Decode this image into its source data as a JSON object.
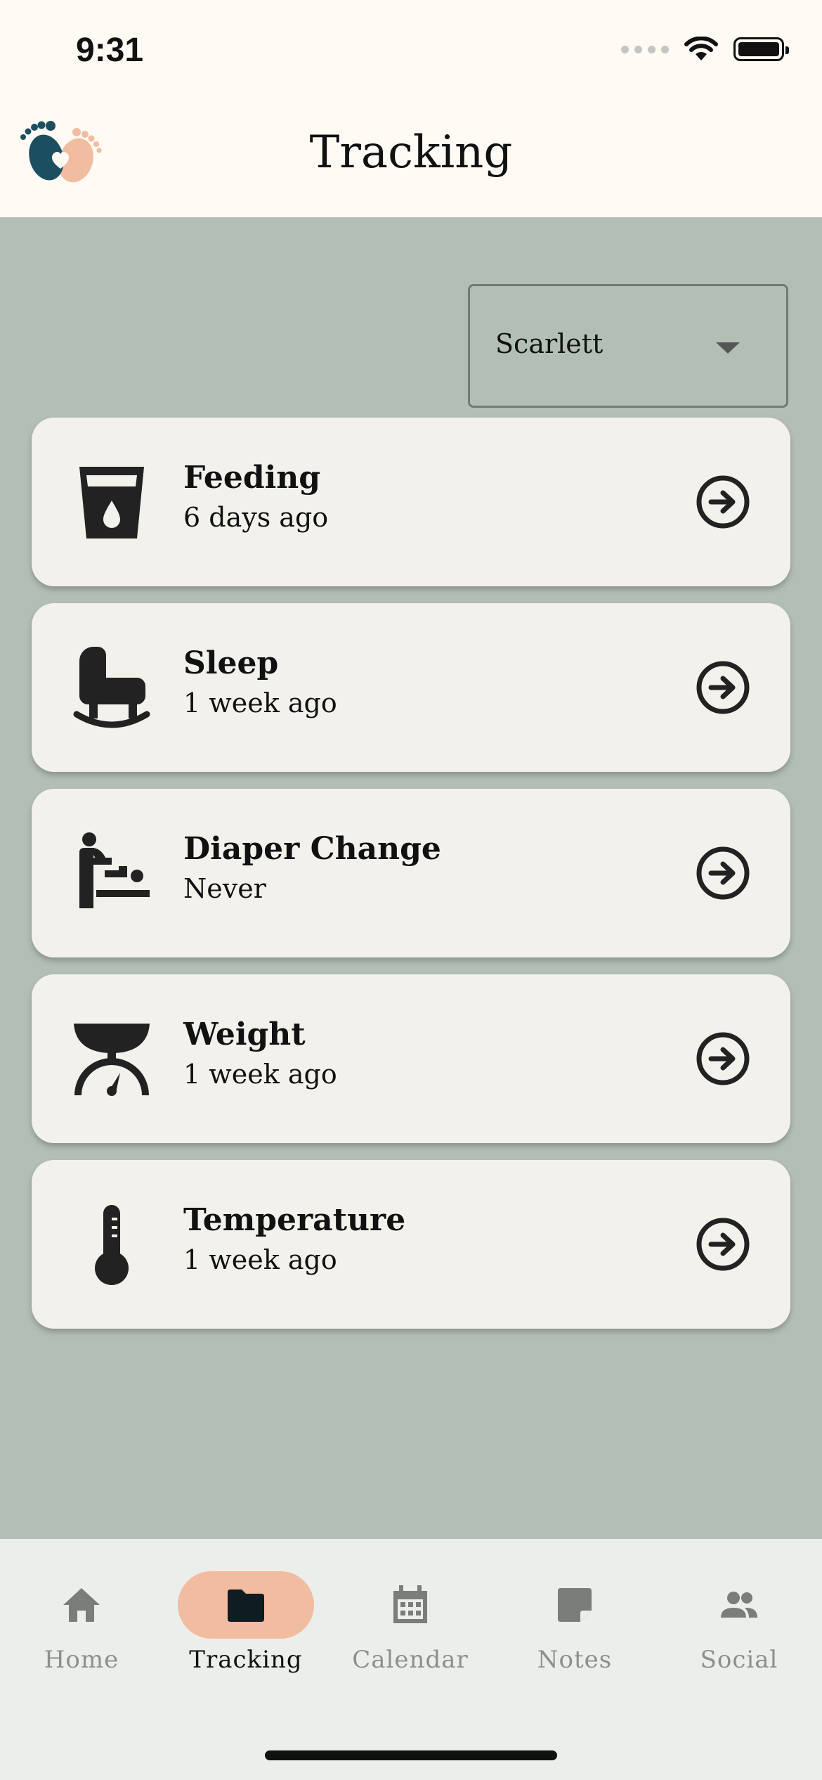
{
  "status_bar": {
    "time": "9:31"
  },
  "header": {
    "title": "Tracking"
  },
  "child_select": {
    "value": "Scarlett"
  },
  "tracking_items": [
    {
      "title": "Feeding",
      "subtitle": "6 days ago",
      "icon": "feeding-cup-icon"
    },
    {
      "title": "Sleep",
      "subtitle": "1 week ago",
      "icon": "rocking-crib-icon"
    },
    {
      "title": "Diaper Change",
      "subtitle": "Never",
      "icon": "baby-changing-icon"
    },
    {
      "title": "Weight",
      "subtitle": "1 week ago",
      "icon": "scale-icon"
    },
    {
      "title": "Temperature",
      "subtitle": "1 week ago",
      "icon": "thermometer-icon"
    }
  ],
  "tab_bar": {
    "active": "Tracking",
    "tabs": [
      {
        "label": "Home",
        "icon": "home-icon"
      },
      {
        "label": "Tracking",
        "icon": "folder-icon"
      },
      {
        "label": "Calendar",
        "icon": "calendar-icon"
      },
      {
        "label": "Notes",
        "icon": "note-icon"
      },
      {
        "label": "Social",
        "icon": "people-icon"
      }
    ]
  },
  "colors": {
    "header_bg": "#fffaf3",
    "page_bg": "#b3bfb5",
    "card_bg": "#f2f1ec",
    "tab_active_pill": "#f1bc9f",
    "logo_dark": "#1b4f60",
    "logo_light": "#f1bc9f"
  }
}
